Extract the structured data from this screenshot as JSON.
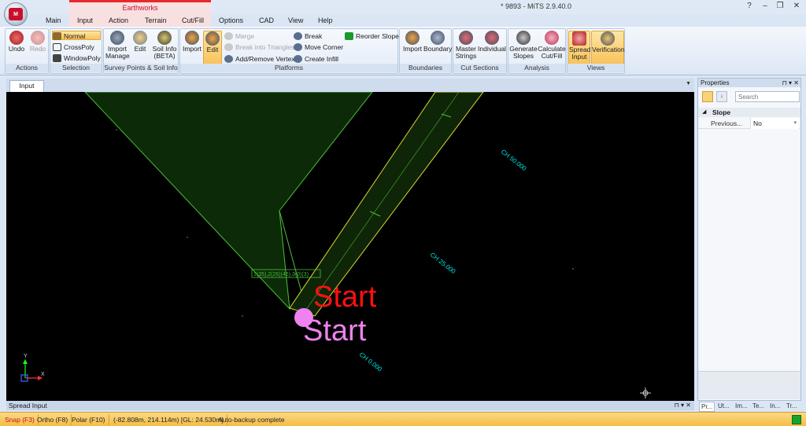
{
  "window": {
    "title": "* 9893 - MiTS 2.9.40.0",
    "help": "?",
    "minimize": "–",
    "restore": "❐",
    "close": "✕"
  },
  "context_group": {
    "label": "Earthworks"
  },
  "tabs": [
    "Main",
    "Input",
    "Action",
    "Terrain",
    "Cut/Fill",
    "Options",
    "CAD",
    "View",
    "Help"
  ],
  "ribbon": {
    "actions": {
      "label": "Actions",
      "undo": "Undo",
      "redo": "Redo"
    },
    "selection": {
      "label": "Selection",
      "normal": "Normal",
      "crosspoly": "CrossPoly",
      "windowpoly": "WindowPoly"
    },
    "survey": {
      "label": "Survey Points & Soil Info",
      "import_manage_1": "Import",
      "import_manage_2": "Manage",
      "edit": "Edit",
      "soil_1": "Soil Info",
      "soil_2": "(BETA)"
    },
    "platforms": {
      "label": "Platforms",
      "import": "Import",
      "edit": "Edit",
      "merge": "Merge",
      "break_triangles": "Break into Triangles",
      "add_remove_vertex": "Add/Remove Vertex",
      "break": "Break",
      "move_corner": "Move Corner",
      "create_infill": "Create Infill",
      "reorder_slope": "Reorder Slope"
    },
    "boundaries": {
      "label": "Boundaries",
      "import": "Import",
      "boundary": "Boundary"
    },
    "cut_sections": {
      "label": "Cut Sections",
      "master_1": "Master",
      "master_2": "Strings",
      "individual": "Individual"
    },
    "analysis": {
      "label": "Analysis",
      "gen_1": "Generate",
      "gen_2": "Slopes",
      "calc_1": "Calculate",
      "calc_2": "Cut/Fill"
    },
    "views": {
      "label": "Views",
      "spread_1": "Spread",
      "spread_2": "Input",
      "verification": "Verification"
    }
  },
  "document": {
    "tab": "Input",
    "dropdown": "▼"
  },
  "canvas": {
    "labels": {
      "start_red": "Start",
      "start_pink": "Start",
      "ch50": "CH 50.000",
      "ch25": "CH 25.000",
      "ch0": "CH 0.000",
      "slope_tag": "1(35),2(26)(46),3(0)(3)"
    },
    "axis": {
      "x": "X",
      "y": "Y"
    },
    "colors": {
      "platform": "#4bbf3a",
      "corridor": "#d8d832",
      "chainage": "#00e5e5",
      "start_red": "#ff1010",
      "start_pink": "#ee82ee"
    }
  },
  "properties": {
    "title": "Properties",
    "ctrls": "⊓ ▾ ✕",
    "search_placeholder": "Search",
    "section": "Slope",
    "row_key": "Previous...",
    "row_value": "No",
    "row_dropdown": "▾"
  },
  "bottom_tabs": [
    "Pr...",
    "Ut...",
    "Im...",
    "Te...",
    "In...",
    "Tr..."
  ],
  "spread_input": {
    "label": "Spread Input",
    "ctrls": "⊓ ▾ ✕"
  },
  "status": {
    "snap": "Snap (F3)",
    "ortho": "Ortho (F8)",
    "polar": "Polar (F10)",
    "coords": "(-82.808m, 214.114m) [GL: 24.530m]",
    "message": "Auto-backup complete"
  }
}
